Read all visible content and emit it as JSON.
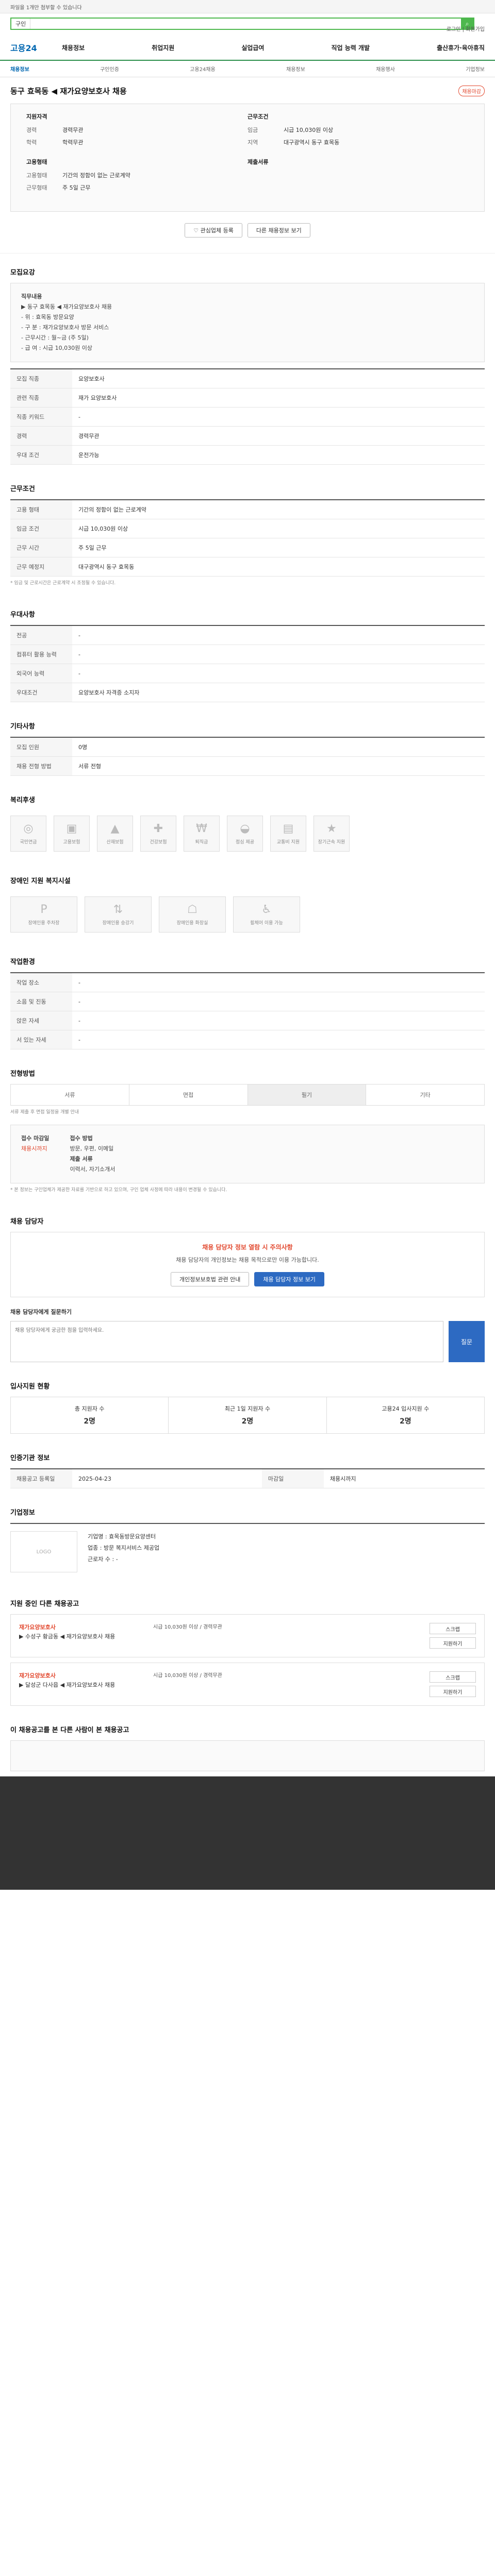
{
  "top": {
    "notice": "파일을 1개만 첨부할 수 있습니다"
  },
  "header": {
    "logo": "고용24",
    "search_pre": "구인",
    "util": "로그인 | 회원가입"
  },
  "gnb": [
    "채용정보",
    "취업지원",
    "실업급여",
    "직업 능력 개발",
    "출산휴가·육아휴직"
  ],
  "snb": [
    "채용정보",
    "구인인증",
    "고용24채용",
    "채용정보",
    "채용행사",
    "기업정보"
  ],
  "title": "동구 효목동 ◀ 재가요양보호사 채용",
  "hiring": "채용마감",
  "summary": {
    "left_h": "지원자격",
    "left": [
      [
        "경력",
        "경력무관"
      ],
      [
        "학력",
        "학력무관"
      ]
    ],
    "right_h": "근무조건",
    "right": [
      [
        "임금",
        "시급 10,030원 이상"
      ],
      [
        "지역",
        "대구광역시 동구 효목동"
      ]
    ],
    "left_h2": "고용형태",
    "left2": [
      [
        "고용형태",
        "기간의 정함이 없는 근로계약"
      ],
      [
        "근무형태",
        "주 5일 근무"
      ]
    ],
    "right_h2": "제출서류"
  },
  "btn": {
    "fav": "관심업체 등록",
    "share": "다른 채용정보 보기"
  },
  "recruit_h": "모집요강",
  "duty_h": "직무내용",
  "duty": [
    "▶ 동구 효목동 ◀ 재가요양보호사 채용",
    "- 위 : 효목동 방문요양",
    "- 구 분 : 재가요양보호사 방문 서비스",
    "- 근무시간 : 월~금 (주 5일)",
    "- 급 여 : 시급 10,030원 이상"
  ],
  "recruit_rows": [
    [
      "모집 직종",
      "요양보호사"
    ],
    [
      "관련 직종",
      "재가 요양보호사"
    ],
    [
      "직종 키워드",
      "-"
    ],
    [
      "경력",
      "경력무관"
    ],
    [
      "우대 조건",
      "운전가능"
    ]
  ],
  "cond_h": "근무조건",
  "cond_rows": [
    [
      "고용 형태",
      "기간의 정함이 없는 근로계약"
    ],
    [
      "임금 조건",
      "시급 10,030원 이상"
    ],
    [
      "근무 시간",
      "주 5일 근무"
    ],
    [
      "근무 예정지",
      "대구광역시 동구 효목동"
    ]
  ],
  "cond_note": "* 임금 및 근로시간은 근로계약 시 조정될 수 있습니다.",
  "pref_h": "우대사항",
  "pref_rows": [
    [
      "전공",
      "-"
    ],
    [
      "컴퓨터 활용 능력",
      "-"
    ],
    [
      "외국어 능력",
      "-"
    ],
    [
      "우대조건",
      "요양보호사 자격증 소지자"
    ]
  ],
  "other_h": "기타사항",
  "other_rows": [
    [
      "모집 인원",
      "0명"
    ],
    [
      "채용 전형 방법",
      "서류 전형"
    ]
  ],
  "benefit_h": "복리후생",
  "benefits": [
    "국민연금",
    "고용보험",
    "산재보험",
    "건강보험",
    "퇴직금",
    "점심 제공",
    "교통비 지원",
    "장기근속 지원"
  ],
  "support_h": "장애인 지원 복지시설",
  "supports": [
    "장애인용 주차장",
    "장애인용 승강기",
    "장애인용 화장실",
    "휠체어 이용 가능"
  ],
  "facility_h": "작업환경",
  "facility_rows": [
    [
      "작업 장소",
      "-"
    ],
    [
      "소음 및 진동",
      "-"
    ],
    [
      "앉은 자세",
      "-"
    ],
    [
      "서 있는 자세",
      "-"
    ]
  ],
  "method_h": "전형방법",
  "methods": [
    "서류",
    "면접",
    "필기",
    "기타"
  ],
  "method_note": "서류 제출 후 면접 일정을 개별 안내",
  "apply": {
    "period_label": "접수 마감일",
    "period": "채용시까지",
    "howto_label": "접수 방법",
    "howto": "방문, 우편, 이메일",
    "doc_label": "제출 서류",
    "doc": "이력서, 자기소개서"
  },
  "caution": "* 본 정보는 구인업체가 제공한 자료를 기반으로 하고 있으며, 구인 업체 사정에 따라 내용이 변경될 수 있습니다.",
  "report_h": "채용 담당자",
  "alert_red": "채용 담당자 정보 열람 시 주의사항",
  "alert_p": "채용 담당자의 개인정보는 채용 목적으로만 이용 가능합니다.",
  "alert_btn1": "개인정보보호법 관련 안내",
  "alert_btn2": "채용 담당자 정보 보기",
  "inquiry_h": "채용 담당자에게 질문하기",
  "inquiry_ph": "채용 담당자에게 궁금한 점을 입력하세요.",
  "inquiry_btn": "질문",
  "stat_h": "입사지원 현황",
  "stats": [
    [
      "총 지원자 수",
      "2명"
    ],
    [
      "최근 1일 지원자 수",
      "2명"
    ],
    [
      "고용24 입사지원 수",
      "2명"
    ]
  ],
  "info_h": "인증기관 정보",
  "info_rows": [
    [
      "채용공고 등록일",
      "2025-04-23"
    ],
    [
      "마감일",
      "채용시까지"
    ]
  ],
  "corp_h": "기업정보",
  "corp_logo": "LOGO",
  "corp": [
    [
      "기업명",
      "효목동방문요양센터"
    ],
    [
      "업종",
      "방문 복지서비스 제공업"
    ],
    [
      "근로자 수",
      "-"
    ]
  ],
  "others_h": "지원 중인 다른 채용공고",
  "others": [
    {
      "co": "재가요양보호사",
      "t": "▶ 수성구 황금동 ◀ 재가요양보호사 채용",
      "m": "시급 10,030원 이상 / 경력무관",
      "s1": "스크랩",
      "s2": "지원하기"
    },
    {
      "co": "재가요양보호사",
      "t": "▶ 달성군 다사읍 ◀ 재가요양보호사 채용",
      "m": "시급 10,030원 이상 / 경력무관",
      "s1": "스크랩",
      "s2": "지원하기"
    }
  ],
  "recommend_h": "이 채용공고를 본 다른 사람이 본 채용공고"
}
